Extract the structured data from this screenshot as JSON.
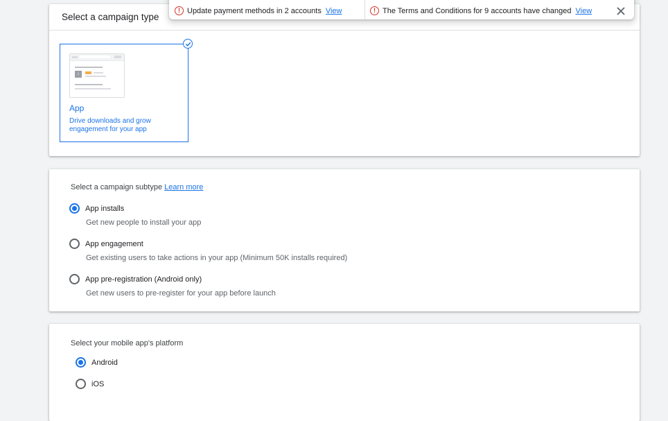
{
  "campaign_type": {
    "title": "Select a campaign type",
    "selected_tile": {
      "name": "App",
      "description": "Drive downloads and grow engagement for your app",
      "icon": "check-circle-icon"
    }
  },
  "subtype": {
    "label": "Select a campaign subtype",
    "learn_more": "Learn more",
    "options": [
      {
        "label": "App installs",
        "description": "Get new people to install your app",
        "selected": true
      },
      {
        "label": "App engagement",
        "description": "Get existing users to take actions in your app (Minimum 50K installs required)",
        "selected": false
      },
      {
        "label": "App pre-registration (Android only)",
        "description": "Get new users to pre-register for your app before launch",
        "selected": false
      }
    ]
  },
  "platform": {
    "label": "Select your mobile app's platform",
    "options": [
      {
        "label": "Android",
        "selected": true
      },
      {
        "label": "iOS",
        "selected": false
      }
    ]
  },
  "notifications": [
    {
      "text": "Update payment methods in 2 accounts",
      "link": "View",
      "icon": "error-icon"
    },
    {
      "text": "The Terms and Conditions for 9 accounts have changed",
      "link": "View",
      "icon": "error-icon"
    }
  ],
  "colors": {
    "accent": "#1a73e8",
    "error": "#d93025",
    "background": "#f1f3f4"
  }
}
